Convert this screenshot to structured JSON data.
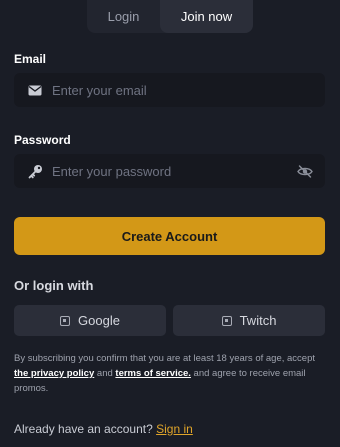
{
  "tabs": [
    {
      "label": "Login",
      "active": false
    },
    {
      "label": "Join now",
      "active": true
    }
  ],
  "email": {
    "label": "Email",
    "placeholder": "Enter your email",
    "value": "",
    "icon": "mail-icon"
  },
  "password": {
    "label": "Password",
    "placeholder": "Enter your password",
    "value": "",
    "icon": "key-icon",
    "toggle_icon": "eye-slash-icon"
  },
  "create_button": {
    "label": "Create Account",
    "color": "#d39817"
  },
  "social": {
    "heading": "Or login with",
    "google_label": "Google",
    "twitch_label": "Twitch"
  },
  "terms": {
    "part1": "By subscribing you confirm that you are at least 18 years of age, accept ",
    "privacy_link": "the privacy policy",
    "part2": " and ",
    "tos_link": "terms of service.",
    "part3": " and agree to receive email promos."
  },
  "signin": {
    "prompt": "Already have an account? ",
    "link": "Sign in",
    "link_color": "#e0a52a"
  },
  "colors": {
    "background": "#1a1d26",
    "field_background": "#16181f",
    "accent": "#d39817"
  }
}
